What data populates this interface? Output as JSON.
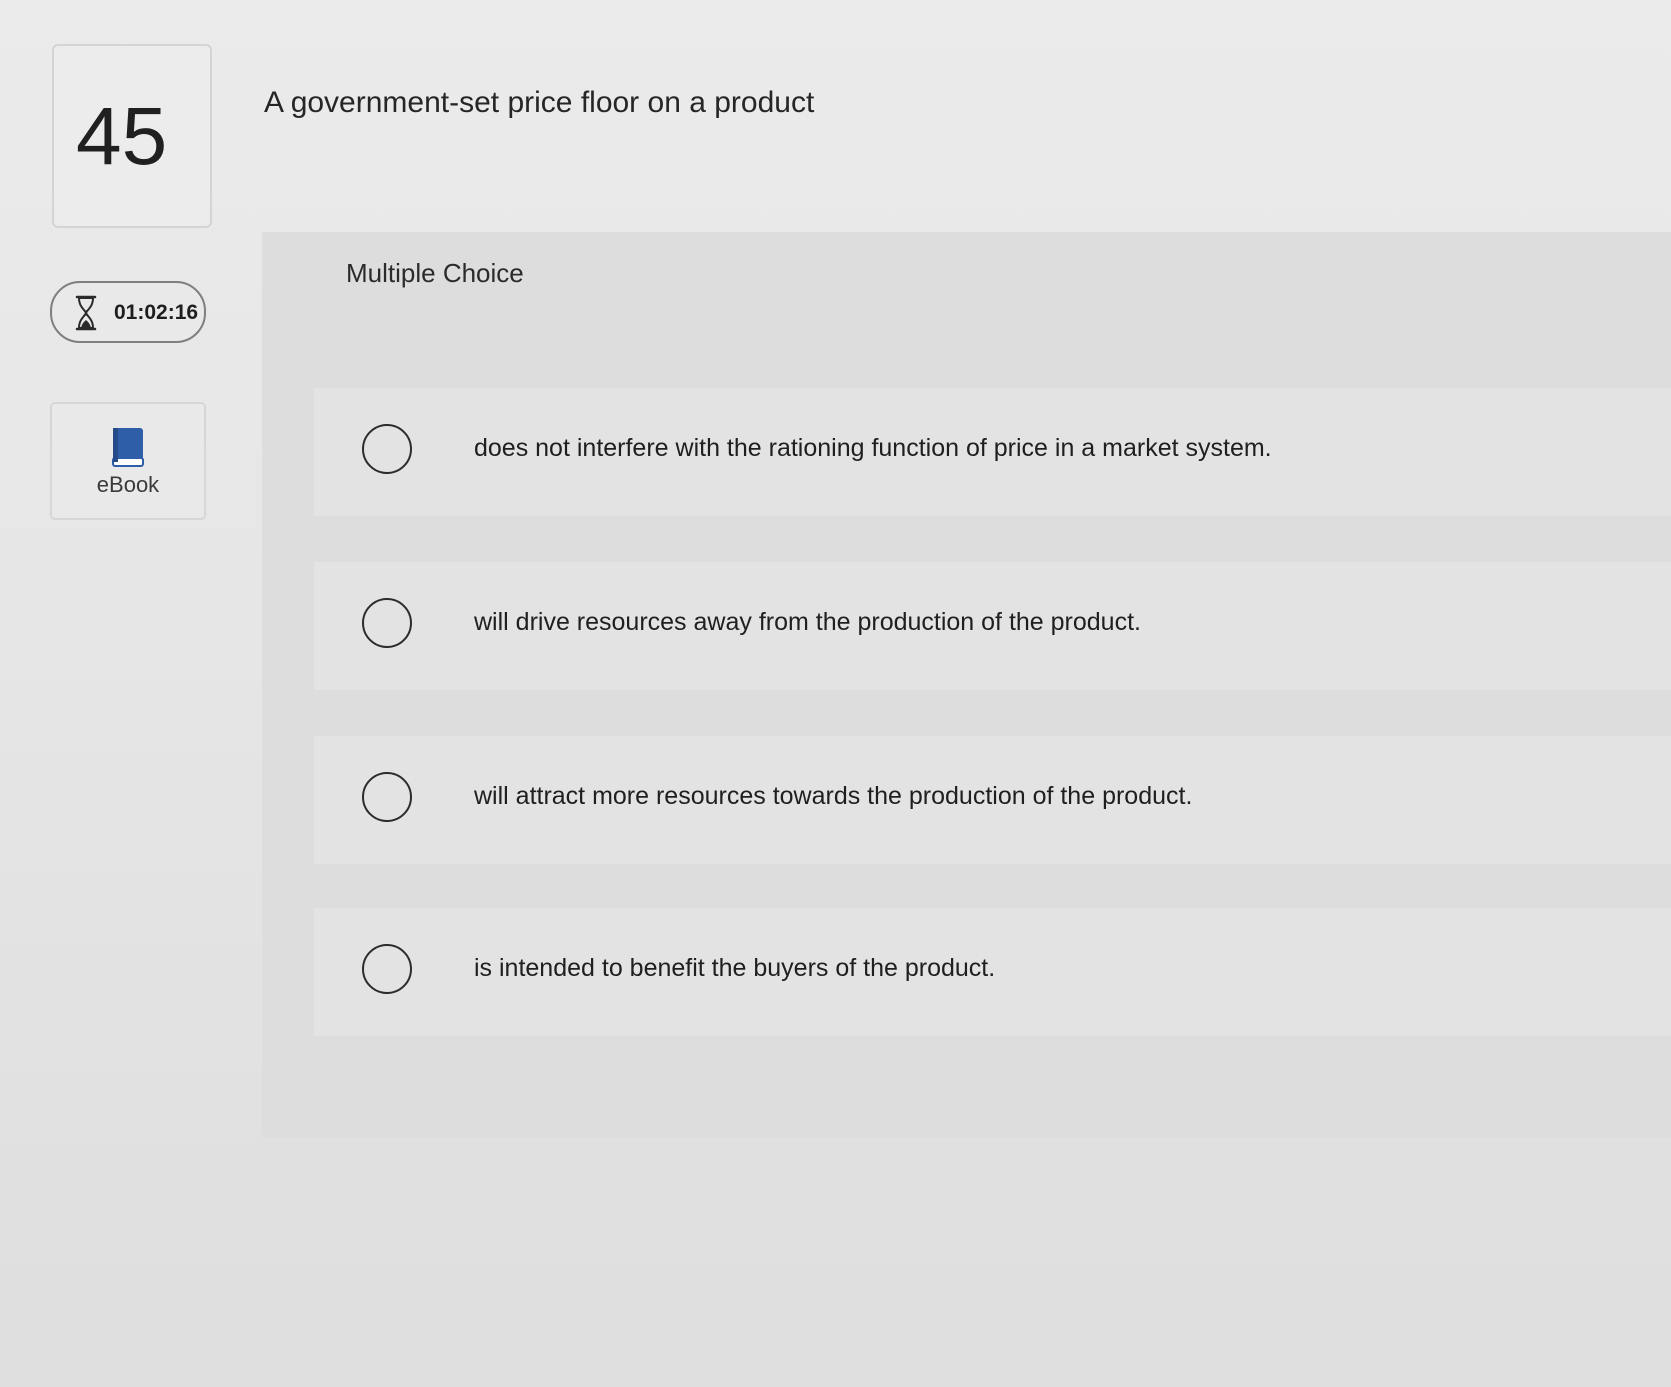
{
  "question": {
    "number": "45",
    "prompt": "A government-set price floor on a product"
  },
  "timer": {
    "icon": "hourglass-icon",
    "time": "01:02:16"
  },
  "ebook": {
    "icon": "book-icon",
    "label": "eBook",
    "accent_color": "#2f5ea8"
  },
  "answer_area": {
    "type_label": "Multiple Choice",
    "choices": [
      {
        "text": "does not interfere with the rationing function of price in a market system.",
        "selected": false
      },
      {
        "text": "will drive resources away from the production of the product.",
        "selected": false
      },
      {
        "text": "will attract more resources towards the production of the product.",
        "selected": false
      },
      {
        "text": "is intended to benefit the buyers of the product.",
        "selected": false
      }
    ]
  }
}
